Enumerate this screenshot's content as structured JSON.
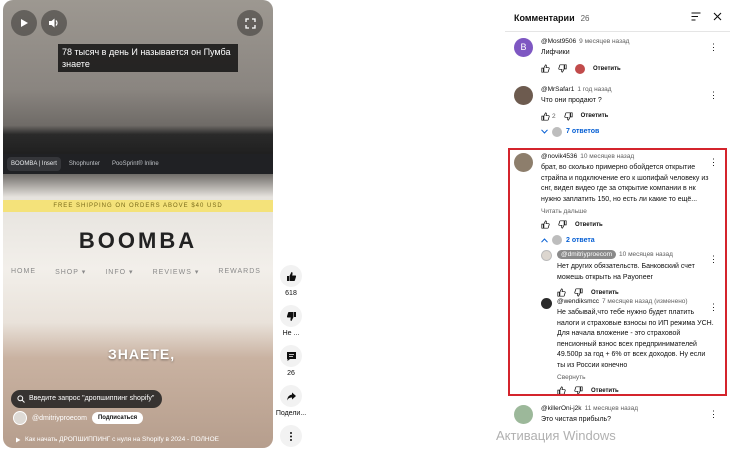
{
  "video": {
    "caption": "78 тысяч в день И называется он Пумба знаете",
    "tabs": [
      "BOOMBA | Insert",
      "Shophunter",
      "PooSprint® Inline"
    ],
    "promo_strip": "FREE SHIPPING ON ORDERS ABOVE $40 USD",
    "site_logo": "BOOMBA",
    "site_nav": [
      "HOME",
      "SHOP ▾",
      "INFO ▾",
      "REVIEWS ▾",
      "REWARDS"
    ],
    "overlay_text": "ЗНАЕТЕ,",
    "search_suggestion": "Введите запрос \"дропшиппинг shopify\"",
    "channel_name": "@dmitriyproecom",
    "subscribe_label": "Подписаться",
    "title": "Как начать ДРОПШИППИНГ с нуля на Shopify в 2024 - ПОЛНОЕ"
  },
  "actions": {
    "like_count": "618",
    "dislike_label": "Не ...",
    "comments_count": "26",
    "share_label": "Подели..."
  },
  "comments_panel": {
    "title": "Комментарии",
    "count": "26",
    "reply_label": "Ответить",
    "comments": [
      {
        "author": "@Most9506",
        "time": "9 месяцев назад",
        "text": "Лифчики",
        "likes": "",
        "avatar_letter": "B"
      },
      {
        "author": "@MrSafar1",
        "time": "1 год назад",
        "text": "Что они продают ?",
        "likes": "2",
        "replies": "7 ответов"
      },
      {
        "author": "@novik4536",
        "time": "10 месяцев назад",
        "text": "брат, во сколько примерно обойдется открытие страйпа и подключение его к шопифай человеку из снг, видел видео где за открытие компании в нк нужно заплатить 150, но есть ли какие то ещё...",
        "read_more": "Читать дальше",
        "likes": "",
        "replies": "2 ответа"
      },
      {
        "author": "@killerOni-j2k",
        "time": "11 месяцев назад",
        "text": "Это чистая прибыль?"
      }
    ],
    "replies": [
      {
        "author": "@dmitriyproecom",
        "time": "10 месяцев назад",
        "text": "Нет других обязательств. Банковский счет можешь открыть на Payoneer"
      },
      {
        "author": "@wendiksmcc",
        "time": "7 месяцев назад (изменено)",
        "text": "Не забывай,что тебе нужно будет платить налоги и страховые взносы по ИП режима УСН. Для начала вложение - это страховой пенсионный взнос всех предпринимателей 49.500р за год + 6% от всех доходов. Ну если ты из России конечно",
        "collapse": "Свернуть"
      }
    ]
  },
  "watermark": "Активация Windows",
  "colors": {
    "highlight": "#d4242c",
    "link": "#065fd4",
    "avatar_purple": "#7e57c2"
  }
}
